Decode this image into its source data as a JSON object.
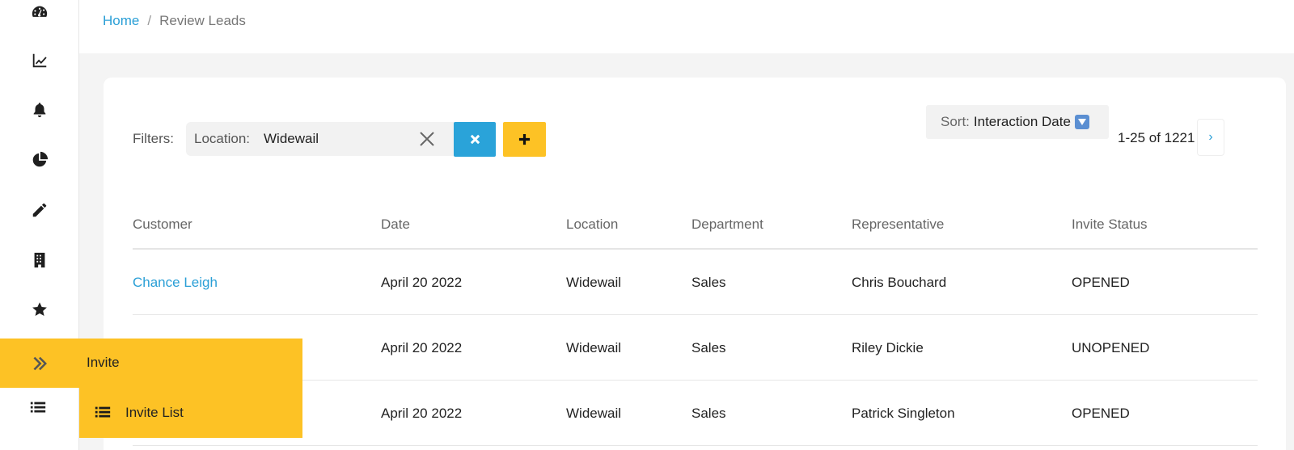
{
  "breadcrumb": {
    "home": "Home",
    "separator": "/",
    "current": "Review Leads"
  },
  "sidebar": {
    "icons": [
      "dashboard-icon",
      "line-chart-icon",
      "bell-icon",
      "pie-chart-icon",
      "pencil-icon",
      "building-icon",
      "star-icon",
      "chevron-double-right-icon",
      "list-icon"
    ]
  },
  "filters": {
    "label": "Filters:",
    "active_key": "Location:",
    "active_value": "Widewail"
  },
  "sort": {
    "label": "Sort:",
    "value": "Interaction Date"
  },
  "pagination": {
    "range": "1-25 of 1221",
    "next": "›"
  },
  "table": {
    "headers": [
      "Customer",
      "Date",
      "Location",
      "Department",
      "Representative",
      "Invite Status"
    ],
    "rows": [
      [
        "Chance Leigh",
        "April 20 2022",
        "Widewail",
        "Sales",
        "Chris Bouchard",
        "OPENED"
      ],
      [
        "",
        "April 20 2022",
        "Widewail",
        "Sales",
        "Riley Dickie",
        "UNOPENED"
      ],
      [
        "",
        "April 20 2022",
        "Widewail",
        "Sales",
        "Patrick Singleton",
        "OPENED"
      ]
    ]
  },
  "flyout": {
    "invite_label": "Invite",
    "invite_list_label": "Invite List"
  },
  "colors": {
    "accent_blue": "#2aa3d9",
    "accent_yellow": "#fdc225"
  }
}
